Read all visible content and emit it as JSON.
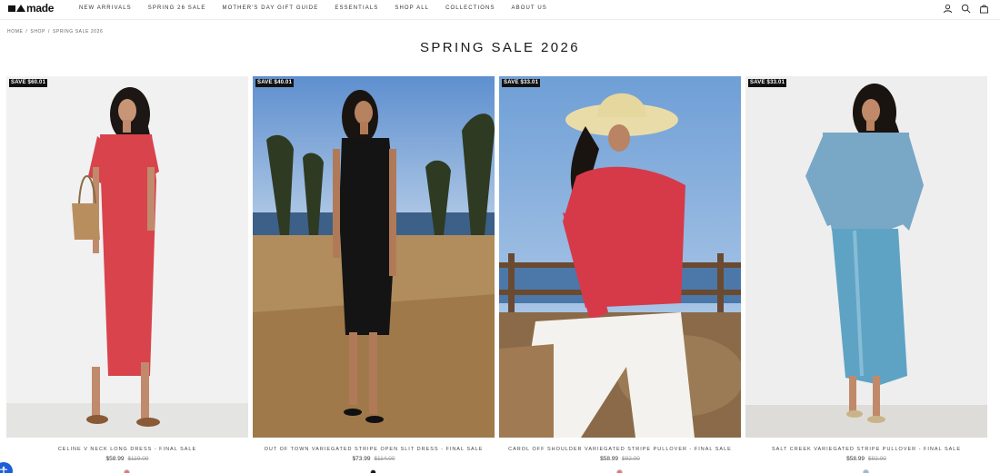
{
  "header": {
    "logo_text": "made",
    "nav": [
      "NEW ARRIVALS",
      "SPRING 26 SALE",
      "MOTHER'S DAY GIFT GUIDE",
      "ESSENTIALS",
      "SHOP ALL",
      "COLLECTIONS",
      "ABOUT US"
    ],
    "icons": [
      "account-icon",
      "search-icon",
      "cart-icon"
    ]
  },
  "breadcrumb": [
    "HOME",
    "SHOP",
    "SPRING SALE 2026"
  ],
  "page_title": "SPRING SALE 2026",
  "products": [
    {
      "badge": "SAVE $60.01",
      "name": "CELINE V NECK LONG DRESS - FINAL SALE",
      "price": "$58.99",
      "old_price": "$119.00",
      "swatch_color": "#e8737b"
    },
    {
      "badge": "SAVE $40.01",
      "name": "OUT OF TOWN VARIEGATED STRIPE OPEN SLIT DRESS - FINAL SALE",
      "price": "$73.99",
      "old_price": "$114.00",
      "swatch_color": "#111111"
    },
    {
      "badge": "SAVE $33.01",
      "name": "CAROL OFF SHOULDER VARIEGATED STRIPE PULLOVER - FINAL SALE",
      "price": "$58.99",
      "old_price": "$92.00",
      "swatch_color": "#e8737b"
    },
    {
      "badge": "SAVE $33.01",
      "name": "SALT CREEK VARIEGATED STRIPE PULLOVER - FINAL SALE",
      "price": "$58.99",
      "old_price": "$92.00",
      "swatch_color": "#9ab8d4"
    }
  ],
  "accessibility_icon": "accessibility-icon"
}
